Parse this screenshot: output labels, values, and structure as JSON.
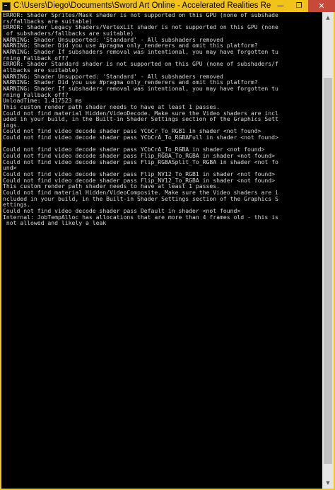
{
  "window": {
    "title": "C:\\Users\\Diego\\Documents\\Sword Art Online - Accelerated Realities Recoded\\..."
  },
  "controls": {
    "minimize_glyph": "—",
    "maximize_glyph": "❐",
    "close_glyph": "✕"
  },
  "scrollbar": {
    "up_glyph": "▲",
    "down_glyph": "▼",
    "thumb_position": 0.12,
    "thumb_size": 0.85
  },
  "console": {
    "lines": [
      "ERROR: Shader Sprites/Mask shader is not supported on this GPU (none of subshade",
      "rs/fallbacks are suitable)",
      "ERROR: Shader Legacy Shaders/VertexLit shader is not supported on this GPU (none",
      " of subshaders/fallbacks are suitable)",
      "WARNING: Shader Unsupported: 'Standard' - All subshaders removed",
      "WARNING: Shader Did you use #pragma only_renderers and omit this platform?",
      "WARNING: Shader If subshaders removal was intentional, you may have forgotten tu",
      "rning Fallback off?",
      "ERROR: Shader Standard shader is not supported on this GPU (none of subshaders/f",
      "allbacks are suitable)",
      "WARNING: Shader Unsupported: 'Standard' - All subshaders removed",
      "WARNING: Shader Did you use #pragma only_renderers and omit this platform?",
      "WARNING: Shader If subshaders removal was intentional, you may have forgotten tu",
      "rning Fallback off?",
      "UnloadTime: 1.417523 ms",
      "This custom render path shader needs to have at least 1 passes.",
      "Could not find material Hidden/VideoDecode. Make sure the Video shaders are incl",
      "uded in your build, in the Built-in Shader Settings section of the Graphics Sett",
      "ings.",
      "Could not find video decode shader pass YCbCr_To_RGB1 in shader <not found>",
      "Could not find video decode shader pass YCbCrA_To_RGBAFull in shader <not found>",
      "",
      "Could not find video decode shader pass YCbCrA_To_RGBA in shader <not found>",
      "Could not find video decode shader pass Flip_RGBA_To_RGBA in shader <not found>",
      "Could not find video decode shader pass Flip_RGBASplit_To_RGBA in shader <not fo",
      "und>",
      "Could not find video decode shader pass Flip_NV12_To_RGB1 in shader <not found>",
      "Could not find video decode shader pass Flip_NV12_To_RGBA in shader <not found>",
      "This custom render path shader needs to have at least 1 passes.",
      "Could not find material Hidden/VideoComposite. Make sure the Video shaders are i",
      "ncluded in your build, in the Built-in Shader Settings section of the Graphics S",
      "ettings.",
      "Could not find video decode shader pass Default in shader <not found>",
      "Internal: JobTempAlloc has allocations that are more than 4 frames old - this is",
      " not allowed and likely a leak"
    ]
  }
}
